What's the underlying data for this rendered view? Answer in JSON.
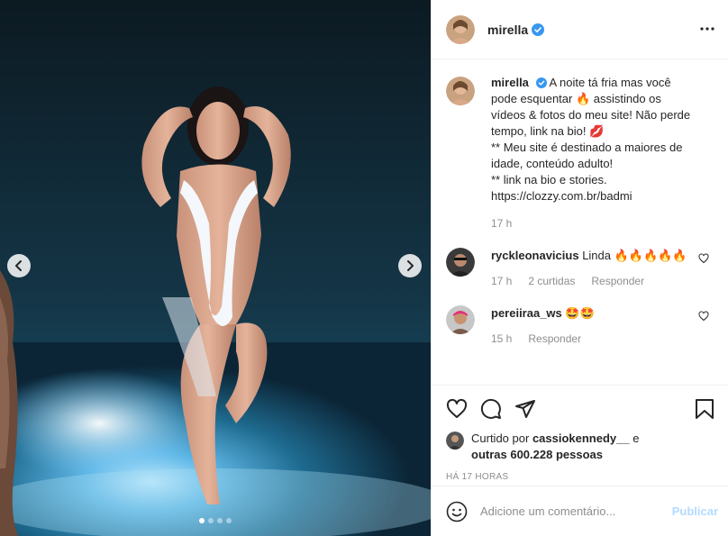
{
  "post": {
    "username": "mirella",
    "header_more_icon": "more-horizontal-icon",
    "caption_lines": [
      "A noite tá fria mas você",
      "pode esquentar 🔥 assistindo os",
      "vídeos & fotos do meu site! Não perde",
      "tempo, link na bio! 💋",
      "** Meu site é destinado a maiores de",
      "idade, conteúdo adulto!",
      "** link na bio e stories.",
      "https://clozzy.com.br/badmi"
    ],
    "caption_time": "17 h"
  },
  "comments": [
    {
      "username": "ryckleonavicius",
      "text": "Linda 🔥🔥🔥🔥🔥",
      "time": "17 h",
      "likes": "2 curtidas",
      "reply": "Responder"
    },
    {
      "username": "pereiiraa_ws",
      "text": "🤩🤩",
      "time": "15 h",
      "reply": "Responder"
    }
  ],
  "likes": {
    "prefix": "Curtido por",
    "user": "cassiokennedy__",
    "joiner": "e",
    "others": "outras 600.228 pessoas"
  },
  "timestamp": "HÁ 17 HORAS",
  "add_comment": {
    "placeholder": "Adicione um comentário...",
    "publish": "Publicar"
  },
  "carousel": {
    "slide_count": 4,
    "active_slide": 1
  },
  "colors": {
    "text": "#262626",
    "secondary": "#8e8e8e",
    "verified": "#3897f0",
    "publish_disabled": "#b3dbff",
    "border": "#efefef"
  }
}
